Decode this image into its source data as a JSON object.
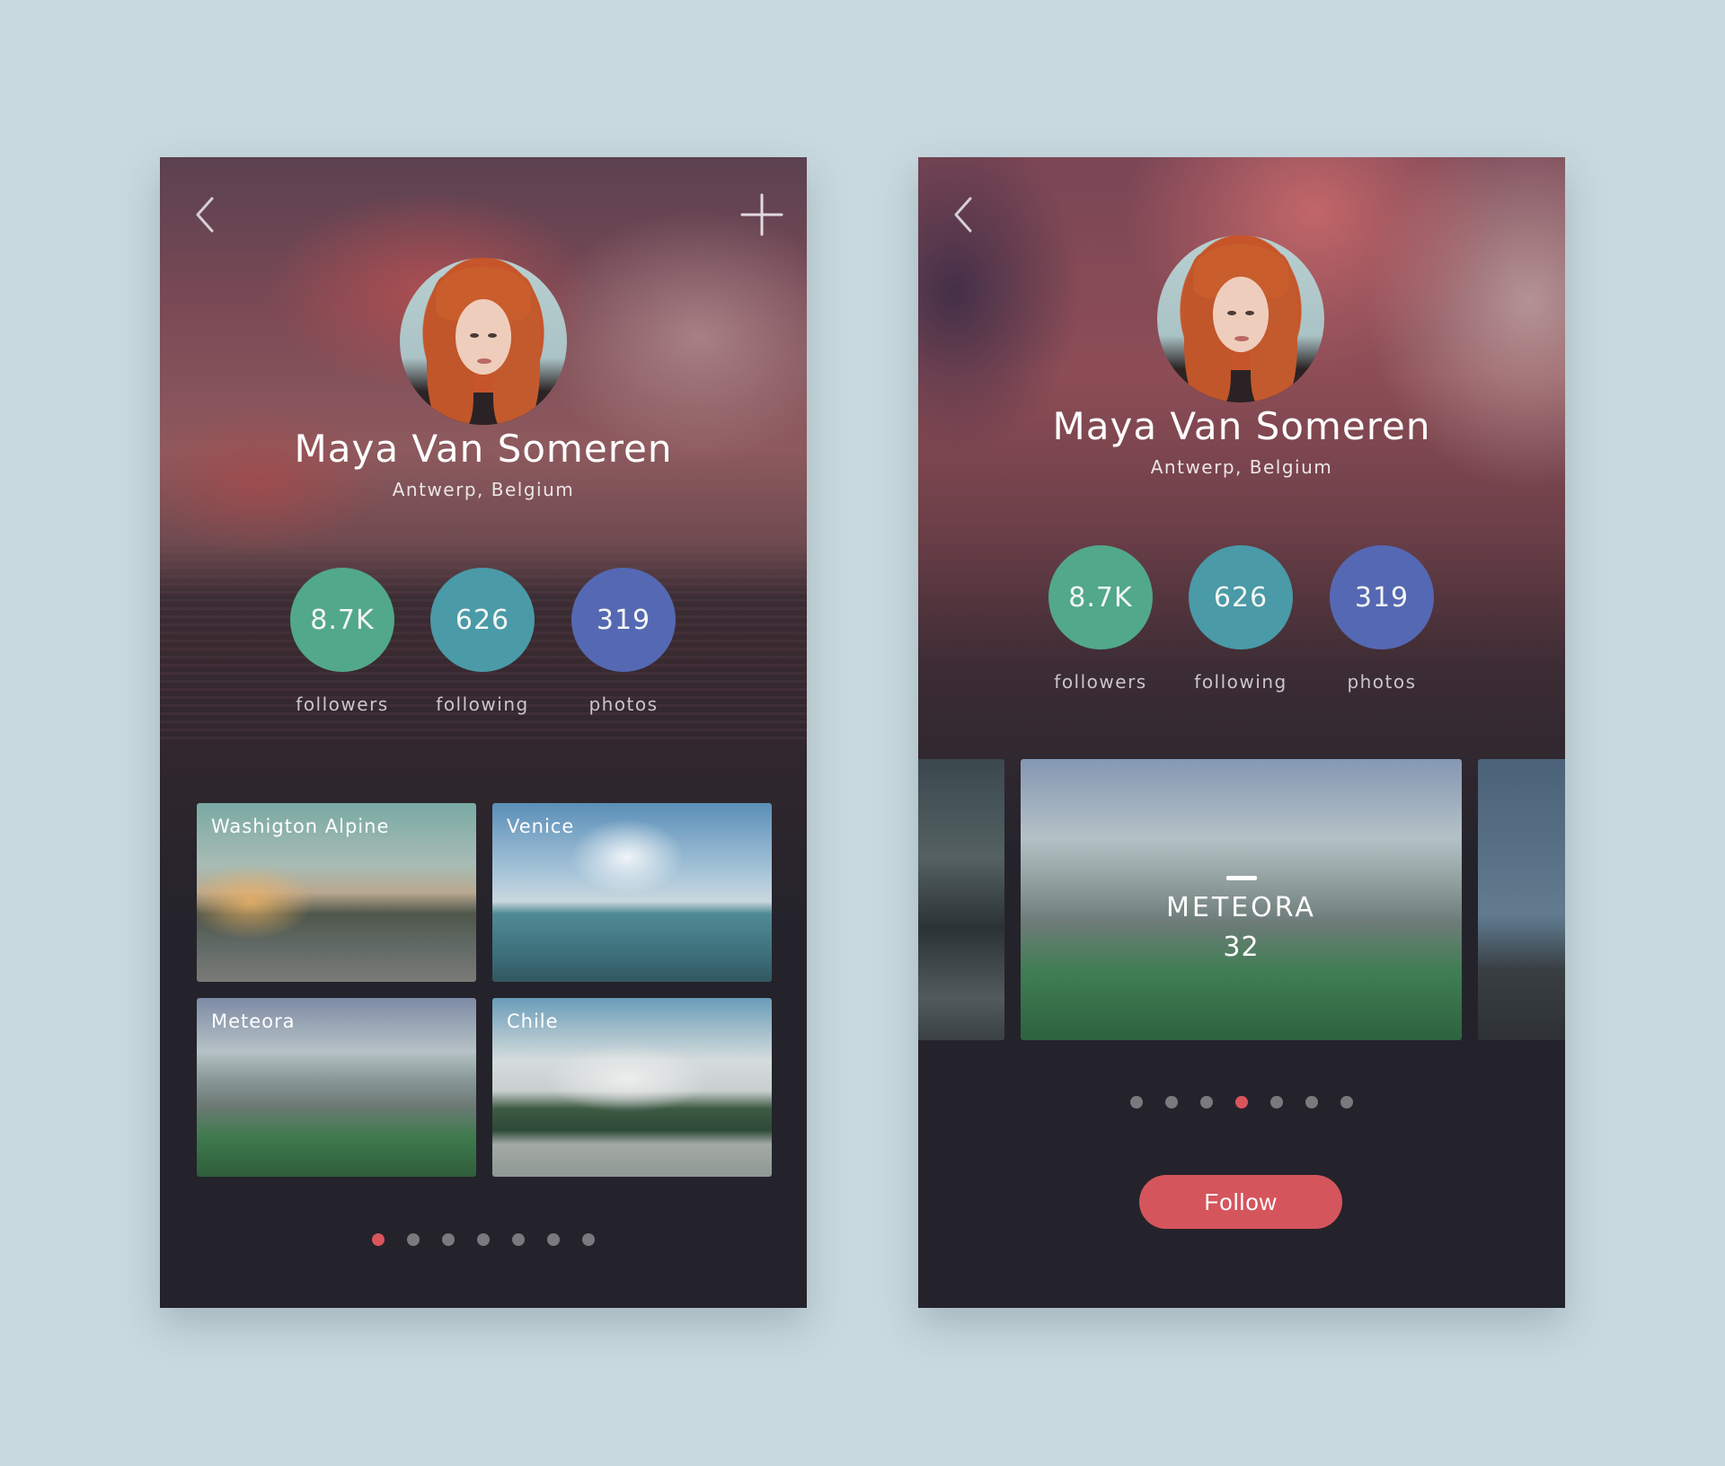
{
  "colors": {
    "background": "#c8d9df",
    "phone_background": "#24232b",
    "followers_circle": "#52a88b",
    "following_circle": "#4a9aa7",
    "photos_circle": "#5568b3",
    "accent_red": "#d5555c",
    "inactive_dot": "#7a7a7e"
  },
  "left_screen": {
    "back_icon": "chevron-left",
    "add_icon": "plus",
    "profile": {
      "name": "Maya Van Someren",
      "location": "Antwerp, Belgium"
    },
    "stats": [
      {
        "value": "8.7K",
        "label": "followers"
      },
      {
        "value": "626",
        "label": "following"
      },
      {
        "value": "319",
        "label": "photos"
      }
    ],
    "albums": [
      {
        "title": "Washigton Alpine"
      },
      {
        "title": "Venice"
      },
      {
        "title": "Meteora"
      },
      {
        "title": "Chile"
      }
    ],
    "pagination": {
      "total": 7,
      "active_index": 0
    }
  },
  "right_screen": {
    "back_icon": "chevron-left",
    "profile": {
      "name": "Maya Van Someren",
      "location": "Antwerp, Belgium"
    },
    "stats": [
      {
        "value": "8.7K",
        "label": "followers"
      },
      {
        "value": "626",
        "label": "following"
      },
      {
        "value": "319",
        "label": "photos"
      }
    ],
    "carousel": {
      "featured_title": "METEORA",
      "featured_count": "32"
    },
    "pagination": {
      "total": 7,
      "active_index": 3
    },
    "follow_button": "Follow"
  }
}
